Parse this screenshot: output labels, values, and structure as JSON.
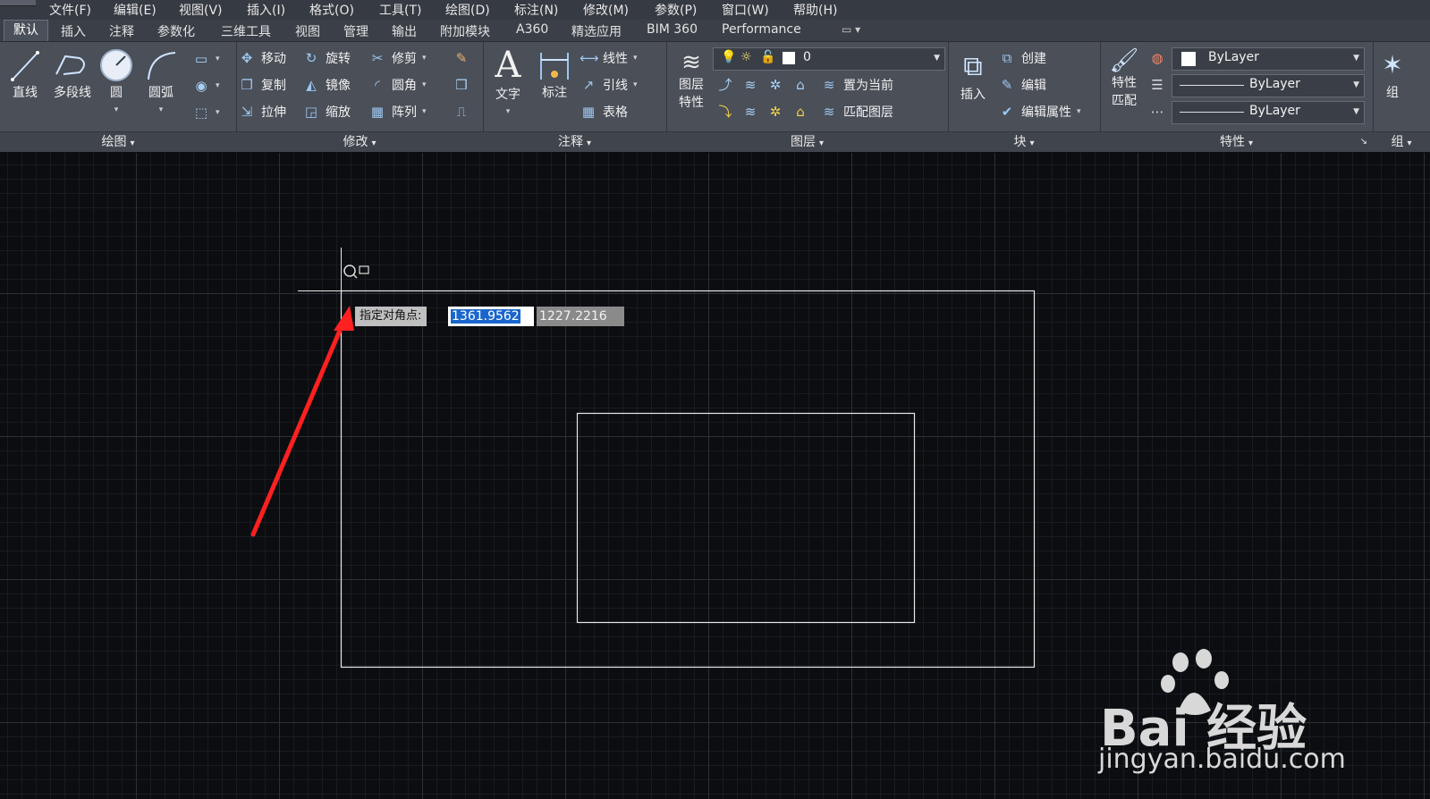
{
  "menu": [
    "文件(F)",
    "编辑(E)",
    "视图(V)",
    "插入(I)",
    "格式(O)",
    "工具(T)",
    "绘图(D)",
    "标注(N)",
    "修改(M)",
    "参数(P)",
    "窗口(W)",
    "帮助(H)"
  ],
  "tabs": [
    "默认",
    "插入",
    "注释",
    "参数化",
    "三维工具",
    "视图",
    "管理",
    "输出",
    "附加模块",
    "A360",
    "精选应用",
    "BIM 360",
    "Performance"
  ],
  "panels": {
    "draw": {
      "title": "绘图",
      "line": "直线",
      "polyline": "多段线",
      "circle": "圆",
      "arc": "圆弧"
    },
    "modify": {
      "title": "修改",
      "move": "移动",
      "rotate": "旋转",
      "trim": "修剪",
      "copy": "复制",
      "mirror": "镜像",
      "fillet": "圆角",
      "stretch": "拉伸",
      "scale": "缩放",
      "array": "阵列"
    },
    "annotation": {
      "title": "注释",
      "text": "文字",
      "dimension": "标注",
      "linear": "线性",
      "leader": "引线",
      "table": "表格"
    },
    "layers": {
      "title": "图层",
      "props1": "图层",
      "props2": "特性",
      "current_layer": "0",
      "make_current": "置为当前",
      "match_layer": "匹配图层"
    },
    "block": {
      "title": "块",
      "insert": "插入",
      "create": "创建",
      "edit": "编辑",
      "edit_attr": "编辑属性"
    },
    "properties": {
      "title": "特性",
      "match1": "特性",
      "match2": "匹配",
      "color": "ByLayer",
      "linetype": "ByLayer",
      "lineweight": "ByLayer"
    },
    "group": {
      "title": "组",
      "group": "组"
    }
  },
  "command": {
    "prompt": "指定对角点:",
    "x_value": "1361.9562",
    "y_value": "1227.2216"
  },
  "watermark": {
    "brand": "Bai  经验",
    "url": "jingyan.baidu.com"
  },
  "colors": {
    "ribbon": "#4a4f58",
    "canvas": "#0b0d10",
    "arrow": "#ff2020",
    "highlight": "#1a66cc"
  }
}
